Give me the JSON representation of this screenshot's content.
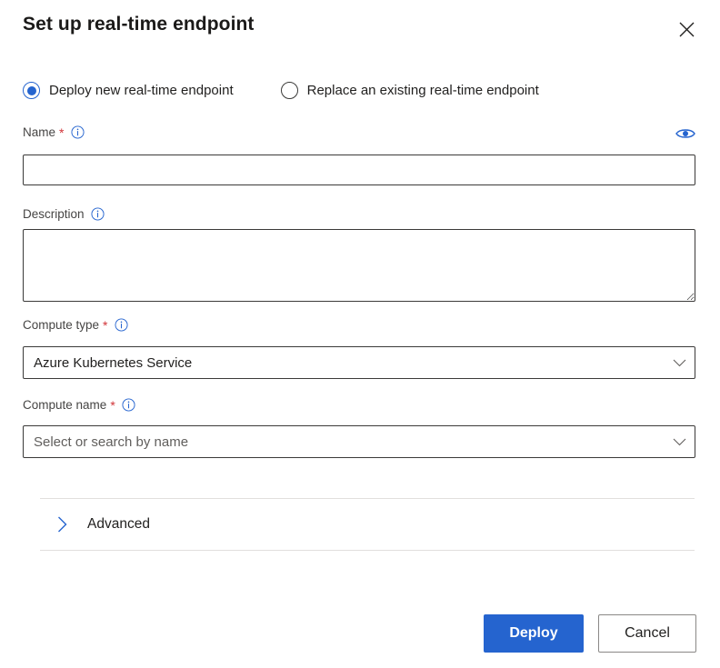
{
  "dialog": {
    "title": "Set up real-time endpoint",
    "close_icon": "close-icon"
  },
  "colors": {
    "accent": "#2564cf",
    "required": "#d13438",
    "border": "#3b3a39",
    "divider": "#e1dfdd",
    "placeholder_text": "#605e5c"
  },
  "deployment_mode": {
    "options": [
      {
        "label": "Deploy new real-time endpoint",
        "selected": true
      },
      {
        "label": "Replace an existing real-time endpoint",
        "selected": false
      }
    ]
  },
  "fields": {
    "name": {
      "label": "Name",
      "required_marker": "*",
      "info_icon": "info-icon",
      "reveal_icon": "eye-icon",
      "value": "",
      "placeholder": ""
    },
    "description": {
      "label": "Description",
      "info_icon": "info-icon",
      "value": "",
      "placeholder": ""
    },
    "compute_type": {
      "label": "Compute type",
      "required_marker": "*",
      "info_icon": "info-icon",
      "value": "Azure Kubernetes Service",
      "chevron_icon": "chevron-down-icon"
    },
    "compute_name": {
      "label": "Compute name",
      "required_marker": "*",
      "info_icon": "info-icon",
      "value": "",
      "placeholder": "Select or search by name",
      "chevron_icon": "chevron-down-icon"
    }
  },
  "advanced_section": {
    "label": "Advanced",
    "expanded": false,
    "chevron_icon": "chevron-right-icon"
  },
  "footer": {
    "primary_label": "Deploy",
    "secondary_label": "Cancel"
  }
}
